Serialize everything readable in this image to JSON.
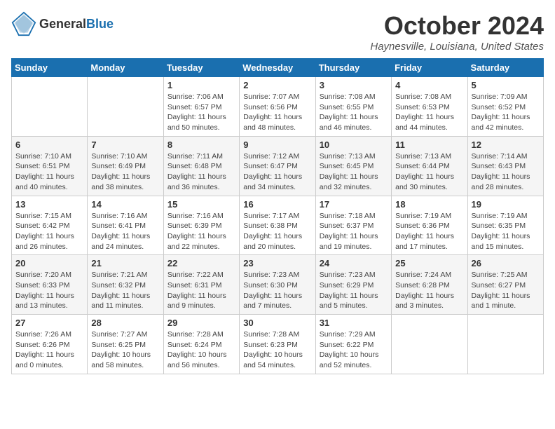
{
  "header": {
    "logo_general": "General",
    "logo_blue": "Blue",
    "month_title": "October 2024",
    "location": "Haynesville, Louisiana, United States"
  },
  "weekdays": [
    "Sunday",
    "Monday",
    "Tuesday",
    "Wednesday",
    "Thursday",
    "Friday",
    "Saturday"
  ],
  "weeks": [
    [
      {
        "day": "",
        "detail": ""
      },
      {
        "day": "",
        "detail": ""
      },
      {
        "day": "1",
        "detail": "Sunrise: 7:06 AM\nSunset: 6:57 PM\nDaylight: 11 hours and 50 minutes."
      },
      {
        "day": "2",
        "detail": "Sunrise: 7:07 AM\nSunset: 6:56 PM\nDaylight: 11 hours and 48 minutes."
      },
      {
        "day": "3",
        "detail": "Sunrise: 7:08 AM\nSunset: 6:55 PM\nDaylight: 11 hours and 46 minutes."
      },
      {
        "day": "4",
        "detail": "Sunrise: 7:08 AM\nSunset: 6:53 PM\nDaylight: 11 hours and 44 minutes."
      },
      {
        "day": "5",
        "detail": "Sunrise: 7:09 AM\nSunset: 6:52 PM\nDaylight: 11 hours and 42 minutes."
      }
    ],
    [
      {
        "day": "6",
        "detail": "Sunrise: 7:10 AM\nSunset: 6:51 PM\nDaylight: 11 hours and 40 minutes."
      },
      {
        "day": "7",
        "detail": "Sunrise: 7:10 AM\nSunset: 6:49 PM\nDaylight: 11 hours and 38 minutes."
      },
      {
        "day": "8",
        "detail": "Sunrise: 7:11 AM\nSunset: 6:48 PM\nDaylight: 11 hours and 36 minutes."
      },
      {
        "day": "9",
        "detail": "Sunrise: 7:12 AM\nSunset: 6:47 PM\nDaylight: 11 hours and 34 minutes."
      },
      {
        "day": "10",
        "detail": "Sunrise: 7:13 AM\nSunset: 6:45 PM\nDaylight: 11 hours and 32 minutes."
      },
      {
        "day": "11",
        "detail": "Sunrise: 7:13 AM\nSunset: 6:44 PM\nDaylight: 11 hours and 30 minutes."
      },
      {
        "day": "12",
        "detail": "Sunrise: 7:14 AM\nSunset: 6:43 PM\nDaylight: 11 hours and 28 minutes."
      }
    ],
    [
      {
        "day": "13",
        "detail": "Sunrise: 7:15 AM\nSunset: 6:42 PM\nDaylight: 11 hours and 26 minutes."
      },
      {
        "day": "14",
        "detail": "Sunrise: 7:16 AM\nSunset: 6:41 PM\nDaylight: 11 hours and 24 minutes."
      },
      {
        "day": "15",
        "detail": "Sunrise: 7:16 AM\nSunset: 6:39 PM\nDaylight: 11 hours and 22 minutes."
      },
      {
        "day": "16",
        "detail": "Sunrise: 7:17 AM\nSunset: 6:38 PM\nDaylight: 11 hours and 20 minutes."
      },
      {
        "day": "17",
        "detail": "Sunrise: 7:18 AM\nSunset: 6:37 PM\nDaylight: 11 hours and 19 minutes."
      },
      {
        "day": "18",
        "detail": "Sunrise: 7:19 AM\nSunset: 6:36 PM\nDaylight: 11 hours and 17 minutes."
      },
      {
        "day": "19",
        "detail": "Sunrise: 7:19 AM\nSunset: 6:35 PM\nDaylight: 11 hours and 15 minutes."
      }
    ],
    [
      {
        "day": "20",
        "detail": "Sunrise: 7:20 AM\nSunset: 6:33 PM\nDaylight: 11 hours and 13 minutes."
      },
      {
        "day": "21",
        "detail": "Sunrise: 7:21 AM\nSunset: 6:32 PM\nDaylight: 11 hours and 11 minutes."
      },
      {
        "day": "22",
        "detail": "Sunrise: 7:22 AM\nSunset: 6:31 PM\nDaylight: 11 hours and 9 minutes."
      },
      {
        "day": "23",
        "detail": "Sunrise: 7:23 AM\nSunset: 6:30 PM\nDaylight: 11 hours and 7 minutes."
      },
      {
        "day": "24",
        "detail": "Sunrise: 7:23 AM\nSunset: 6:29 PM\nDaylight: 11 hours and 5 minutes."
      },
      {
        "day": "25",
        "detail": "Sunrise: 7:24 AM\nSunset: 6:28 PM\nDaylight: 11 hours and 3 minutes."
      },
      {
        "day": "26",
        "detail": "Sunrise: 7:25 AM\nSunset: 6:27 PM\nDaylight: 11 hours and 1 minute."
      }
    ],
    [
      {
        "day": "27",
        "detail": "Sunrise: 7:26 AM\nSunset: 6:26 PM\nDaylight: 11 hours and 0 minutes."
      },
      {
        "day": "28",
        "detail": "Sunrise: 7:27 AM\nSunset: 6:25 PM\nDaylight: 10 hours and 58 minutes."
      },
      {
        "day": "29",
        "detail": "Sunrise: 7:28 AM\nSunset: 6:24 PM\nDaylight: 10 hours and 56 minutes."
      },
      {
        "day": "30",
        "detail": "Sunrise: 7:28 AM\nSunset: 6:23 PM\nDaylight: 10 hours and 54 minutes."
      },
      {
        "day": "31",
        "detail": "Sunrise: 7:29 AM\nSunset: 6:22 PM\nDaylight: 10 hours and 52 minutes."
      },
      {
        "day": "",
        "detail": ""
      },
      {
        "day": "",
        "detail": ""
      }
    ]
  ]
}
